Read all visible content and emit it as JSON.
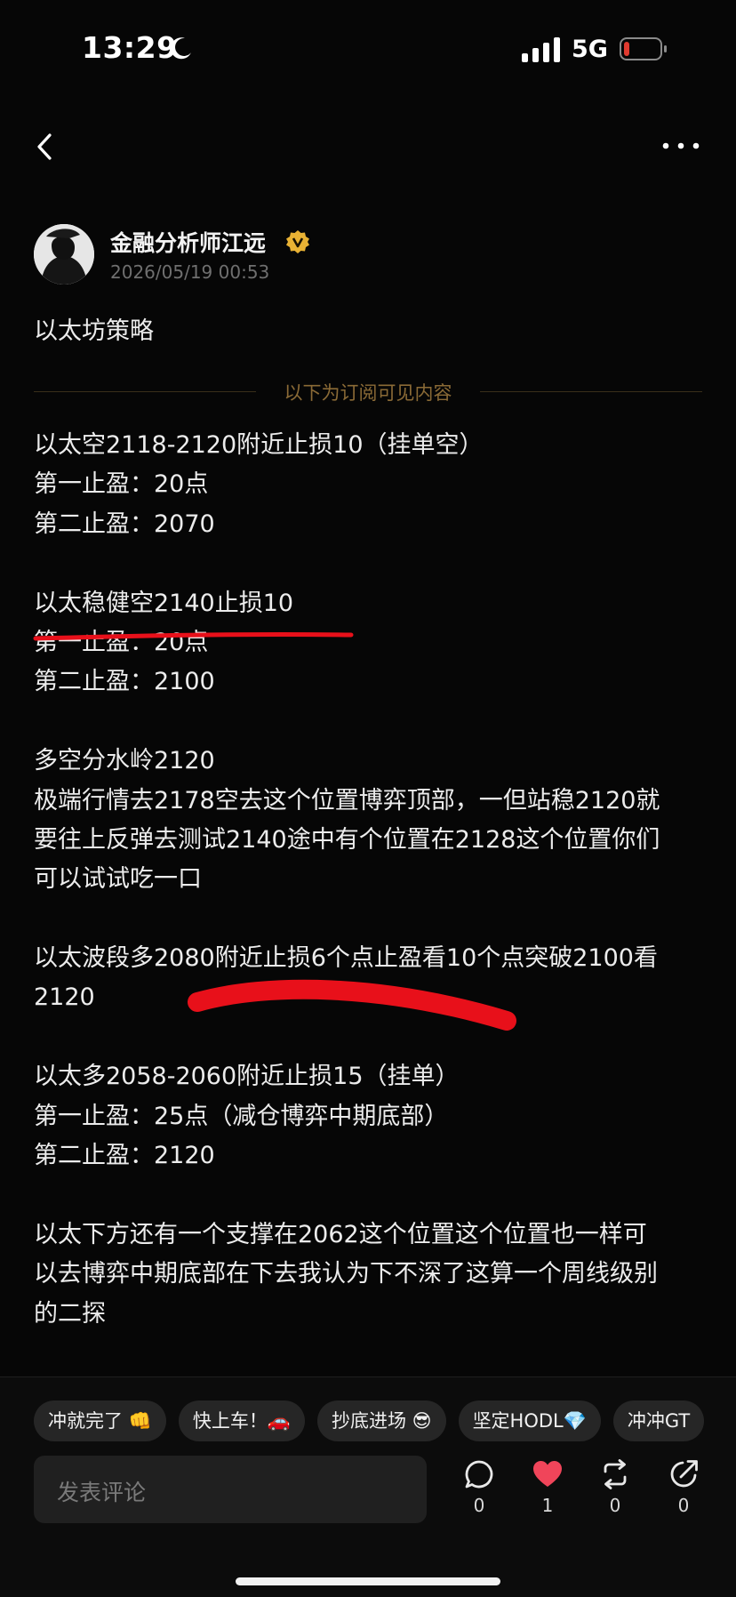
{
  "status_bar": {
    "time": "13:29",
    "network": "5G",
    "icons": [
      "moon-icon",
      "signal-icon",
      "battery-low-icon"
    ],
    "battery_color": "#e03a2f"
  },
  "nav": {
    "back_icon": "chevron-left-icon",
    "more_icon": "more-dots-icon"
  },
  "post": {
    "author": "金融分析师江远",
    "verified_icon": "verified-badge-icon",
    "timestamp": "2026/05/19 00:53",
    "title": "以太坊策略",
    "subscription_divider": "以下为订阅可见内容",
    "lines": [
      "以太空2118-2120附近止损10（挂单空）",
      "第一止盈：20点",
      "第二止盈：2070",
      "",
      "以太稳健空2140止损10",
      "第一止盈：20点",
      "第二止盈：2100",
      "",
      "多空分水岭2120",
      "极端行情去2178空去这个位置博弈顶部，一但站稳2120就",
      "要往上反弹去测试2140途中有个位置在2128这个位置你们",
      "可以试试吃一口",
      "",
      "以太波段多2080附近止损6个点止盈看10个点突破2100看",
      "2120",
      "",
      "以太多2058-2060附近止损15（挂单）",
      "第一止盈：25点（减仓博弈中期底部）",
      "第二止盈：2120",
      "",
      "以太下方还有一个支撑在2062这个位置这个位置也一样可",
      "以去博弈中期底部在下去我认为下不深了这算一个周线级别",
      "的二探"
    ],
    "annotation_color": "#e8101a"
  },
  "bottom_bar": {
    "quick_replies": [
      "冲就完了 👊",
      "快上车！🚗",
      "抄底进场 😎",
      "坚定HODL💎",
      "冲冲GT"
    ],
    "comment_placeholder": "发表评论",
    "actions": [
      {
        "icon": "comment-icon",
        "count": "0"
      },
      {
        "icon": "heart-icon",
        "count": "1"
      },
      {
        "icon": "repost-icon",
        "count": "0"
      },
      {
        "icon": "share-icon",
        "count": "0"
      }
    ],
    "like_color": "#f0455a"
  }
}
